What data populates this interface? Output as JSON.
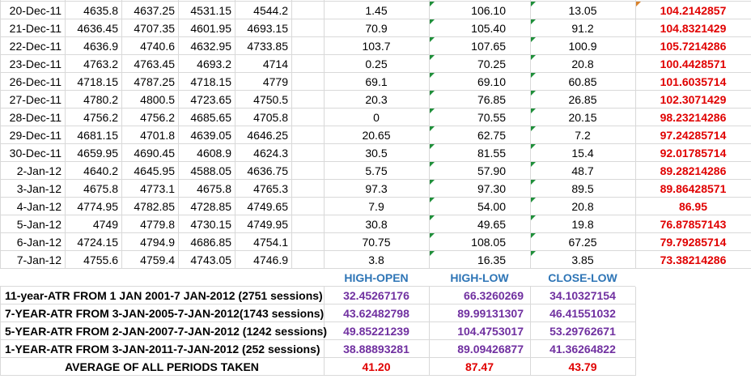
{
  "daily_rows": [
    {
      "date": "20-Dec-11",
      "open": "4635.8",
      "high": "4637.25",
      "low": "4531.15",
      "close": "4544.2",
      "high_open": "1.45",
      "high_low": "106.10",
      "close_low": "13.05",
      "atr": "104.2142857"
    },
    {
      "date": "21-Dec-11",
      "open": "4636.45",
      "high": "4707.35",
      "low": "4601.95",
      "close": "4693.15",
      "high_open": "70.9",
      "high_low": "105.40",
      "close_low": "91.2",
      "atr": "104.8321429"
    },
    {
      "date": "22-Dec-11",
      "open": "4636.9",
      "high": "4740.6",
      "low": "4632.95",
      "close": "4733.85",
      "high_open": "103.7",
      "high_low": "107.65",
      "close_low": "100.9",
      "atr": "105.7214286"
    },
    {
      "date": "23-Dec-11",
      "open": "4763.2",
      "high": "4763.45",
      "low": "4693.2",
      "close": "4714",
      "high_open": "0.25",
      "high_low": "70.25",
      "close_low": "20.8",
      "atr": "100.4428571"
    },
    {
      "date": "26-Dec-11",
      "open": "4718.15",
      "high": "4787.25",
      "low": "4718.15",
      "close": "4779",
      "high_open": "69.1",
      "high_low": "69.10",
      "close_low": "60.85",
      "atr": "101.6035714"
    },
    {
      "date": "27-Dec-11",
      "open": "4780.2",
      "high": "4800.5",
      "low": "4723.65",
      "close": "4750.5",
      "high_open": "20.3",
      "high_low": "76.85",
      "close_low": "26.85",
      "atr": "102.3071429"
    },
    {
      "date": "28-Dec-11",
      "open": "4756.2",
      "high": "4756.2",
      "low": "4685.65",
      "close": "4705.8",
      "high_open": "0",
      "high_low": "70.55",
      "close_low": "20.15",
      "atr": "98.23214286"
    },
    {
      "date": "29-Dec-11",
      "open": "4681.15",
      "high": "4701.8",
      "low": "4639.05",
      "close": "4646.25",
      "high_open": "20.65",
      "high_low": "62.75",
      "close_low": "7.2",
      "atr": "97.24285714"
    },
    {
      "date": "30-Dec-11",
      "open": "4659.95",
      "high": "4690.45",
      "low": "4608.9",
      "close": "4624.3",
      "high_open": "30.5",
      "high_low": "81.55",
      "close_low": "15.4",
      "atr": "92.01785714"
    },
    {
      "date": "2-Jan-12",
      "open": "4640.2",
      "high": "4645.95",
      "low": "4588.05",
      "close": "4636.75",
      "high_open": "5.75",
      "high_low": "57.90",
      "close_low": "48.7",
      "atr": "89.28214286"
    },
    {
      "date": "3-Jan-12",
      "open": "4675.8",
      "high": "4773.1",
      "low": "4675.8",
      "close": "4765.3",
      "high_open": "97.3",
      "high_low": "97.30",
      "close_low": "89.5",
      "atr": "89.86428571"
    },
    {
      "date": "4-Jan-12",
      "open": "4774.95",
      "high": "4782.85",
      "low": "4728.85",
      "close": "4749.65",
      "high_open": "7.9",
      "high_low": "54.00",
      "close_low": "20.8",
      "atr": "86.95"
    },
    {
      "date": "5-Jan-12",
      "open": "4749",
      "high": "4779.8",
      "low": "4730.15",
      "close": "4749.95",
      "high_open": "30.8",
      "high_low": "49.65",
      "close_low": "19.8",
      "atr": "76.87857143"
    },
    {
      "date": "6-Jan-12",
      "open": "4724.15",
      "high": "4794.9",
      "low": "4686.85",
      "close": "4754.1",
      "high_open": "70.75",
      "high_low": "108.05",
      "close_low": "67.25",
      "atr": "79.79285714"
    },
    {
      "date": "7-Jan-12",
      "open": "4755.6",
      "high": "4759.4",
      "low": "4743.05",
      "close": "4746.9",
      "high_open": "3.8",
      "high_low": "16.35",
      "close_low": "3.85",
      "atr": "73.38214286"
    }
  ],
  "summary_headers": {
    "high_open": "HIGH-OPEN",
    "high_low": "HIGH-LOW",
    "close_low": "CLOSE-LOW"
  },
  "summary_rows": [
    {
      "label": "11-year-ATR FROM 1 JAN 2001-7 JAN-2012 (2751 sessions)",
      "high_open": "32.45267176",
      "high_low": "66.3260269",
      "close_low": "34.10327154"
    },
    {
      "label": "7-YEAR-ATR FROM 3-JAN-2005-7-JAN-2012(1743 sessions)",
      "high_open": "43.62482798",
      "high_low": "89.99131307",
      "close_low": "46.41551032"
    },
    {
      "label": "5-YEAR-ATR FROM 2-JAN-2007-7-JAN-2012 (1242 sessions)",
      "high_open": "49.85221239",
      "high_low": "104.4753017",
      "close_low": "53.29762671"
    },
    {
      "label": "1-YEAR-ATR FROM 3-JAN-2011-7-JAN-2012  (252 sessions)",
      "high_open": "38.88893281",
      "high_low": "89.09426877",
      "close_low": "41.36264822"
    }
  ],
  "average_row": {
    "label": "AVERAGE OF ALL PERIODS TAKEN",
    "high_open": "41.20",
    "high_low": "87.47",
    "close_low": "43.79"
  },
  "colors": {
    "atr_red": "#e00000",
    "header_blue": "#2e75b6",
    "value_purple": "#7030a0",
    "gridline": "#d9d9d9",
    "indicator_green": "#1f8f3a"
  }
}
